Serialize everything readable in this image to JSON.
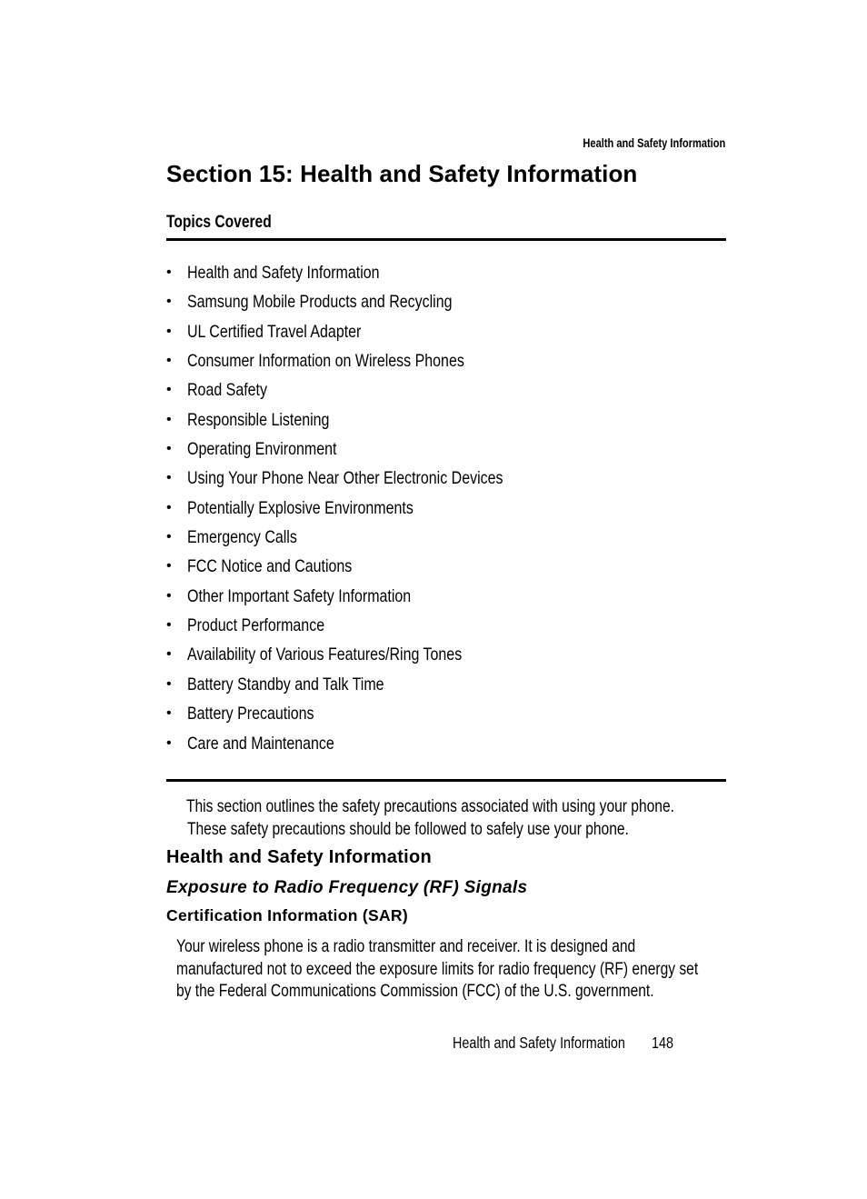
{
  "running_header": "Health and Safety Information",
  "section_title": "Section 15: Health and Safety Information",
  "topics_heading": "Topics Covered",
  "bullet_glyph": "•",
  "topics": [
    "Health and Safety Information",
    "Samsung Mobile Products and Recycling",
    "UL Certified Travel Adapter",
    "Consumer Information on Wireless Phones",
    "Road Safety",
    "Responsible Listening",
    "Operating Environment",
    "Using Your Phone Near Other Electronic Devices",
    "Potentially Explosive Environments",
    "Emergency Calls",
    "FCC Notice and Cautions",
    "Other Important Safety Information",
    "Product Performance",
    "Availability of Various Features/Ring Tones",
    "Battery Standby and Talk Time",
    "Battery Precautions",
    "Care and Maintenance"
  ],
  "intro": {
    "line1": "This section outlines the safety precautions associated with using your phone.",
    "line2": "These safety precautions should be followed to safely use your phone."
  },
  "headings": {
    "h1": "Health and Safety Information",
    "h2": "Exposure to Radio Frequency (RF) Signals",
    "h3": "Certification Information (SAR)"
  },
  "body": {
    "line1": "Your wireless phone is a radio transmitter and receiver. It is designed and",
    "line2": "manufactured not to exceed the exposure limits for radio frequency (RF) energy set",
    "line3": "by the Federal Communications Commission (FCC) of the U.S. government."
  },
  "footer": {
    "label": "Health and Safety Information",
    "page_number": "148"
  }
}
